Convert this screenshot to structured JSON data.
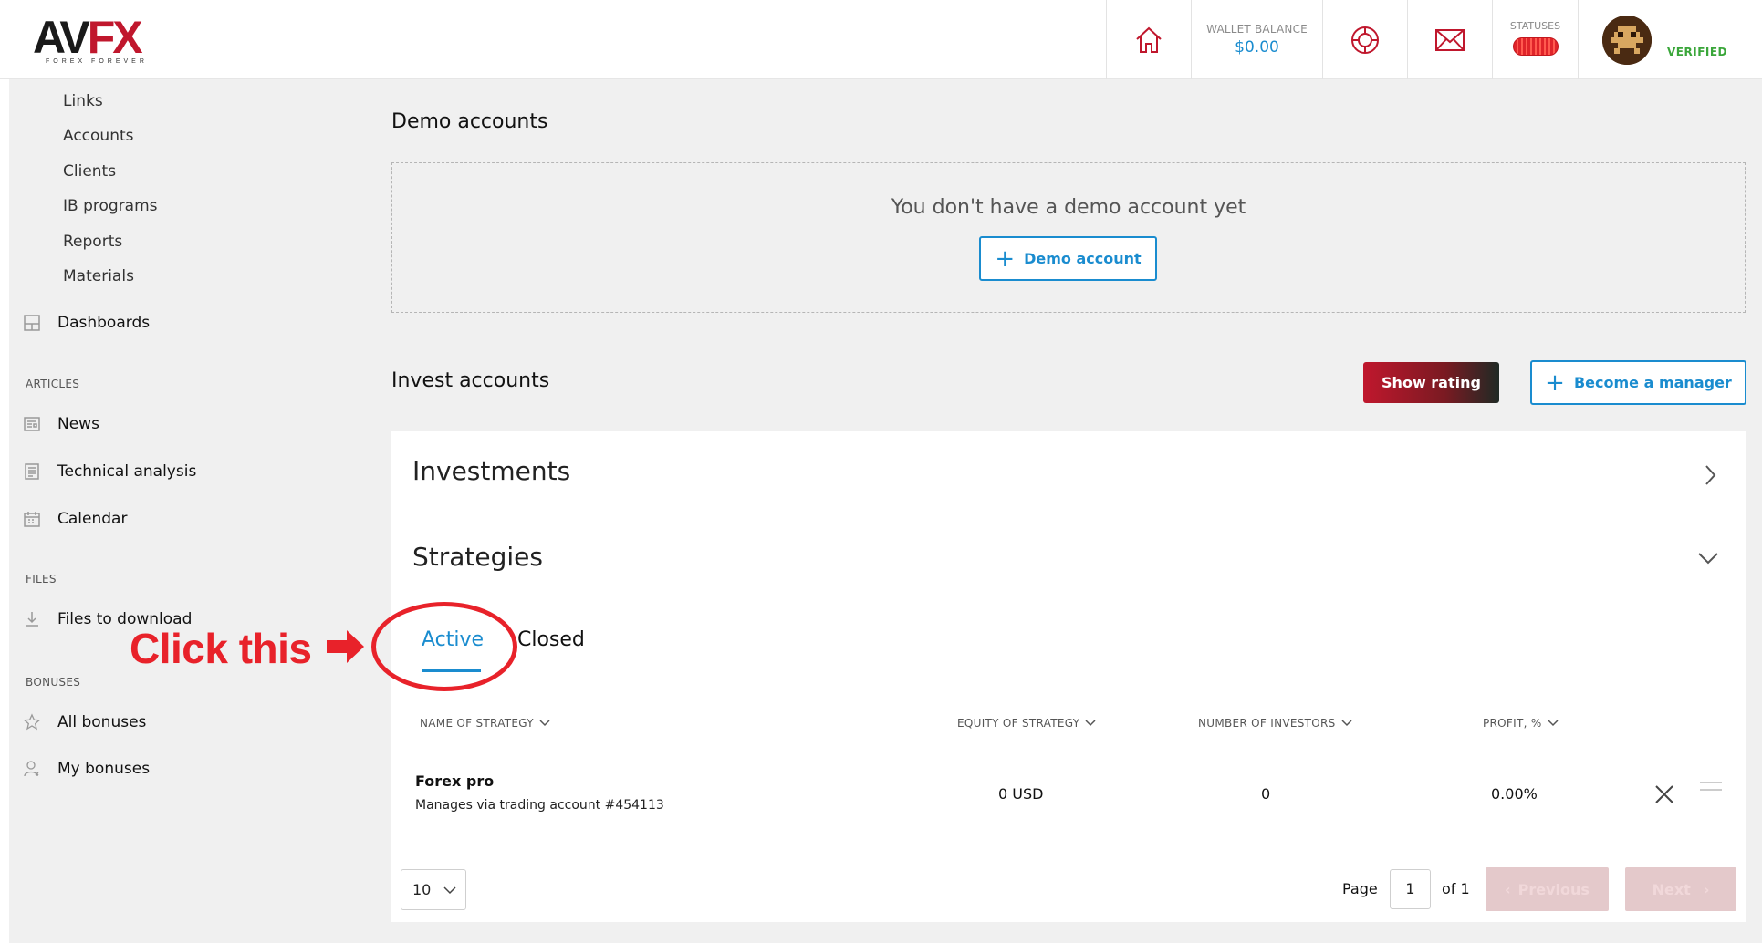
{
  "header": {
    "logo_text_a": "AV",
    "logo_text_b": "FX",
    "logo_sub": "FOREX FOREVER",
    "wallet_label": "WALLET BALANCE",
    "wallet_value": "$0.00",
    "statuses_label": "STATUSES",
    "verified_label": "VERIFIED",
    "icons": [
      "home-icon",
      "lifebuoy-icon",
      "mail-icon"
    ]
  },
  "sidebar": {
    "sub_items": [
      "Links",
      "Accounts",
      "Clients",
      "IB programs",
      "Reports",
      "Materials"
    ],
    "dashboards": "Dashboards",
    "articles_label": "ARTICLES",
    "articles": [
      "News",
      "Technical analysis",
      "Calendar"
    ],
    "files_label": "FILES",
    "files": [
      "Files to download"
    ],
    "bonuses_label": "BONUSES",
    "bonuses": [
      "All bonuses",
      "My bonuses"
    ]
  },
  "demo": {
    "title": "Demo accounts",
    "empty_text": "You don't have a demo account yet",
    "button_label": "Demo account"
  },
  "invest": {
    "title": "Invest accounts",
    "show_rating": "Show rating",
    "become_manager": "Become a manager",
    "investments_heading": "Investments",
    "strategies_heading": "Strategies",
    "tabs": [
      "Active",
      "Closed"
    ],
    "columns": [
      "NAME OF STRATEGY",
      "EQUITY OF STRATEGY",
      "NUMBER OF INVESTORS",
      "PROFIT, %"
    ],
    "rows": [
      {
        "name": "Forex pro",
        "sub": "Manages via trading account #454113",
        "equity": "0 USD",
        "investors": "0",
        "profit": "0.00%"
      }
    ],
    "pagination": {
      "per_page": "10",
      "page_label": "Page",
      "page_value": "1",
      "of_label": "of 1",
      "previous": "Previous",
      "next": "Next"
    }
  },
  "annotation": {
    "text": "Click this"
  },
  "colors": {
    "accent": "#1a8ccf",
    "brand_red": "#c0172d",
    "annotation_red": "#e8222a",
    "verified_green": "#3aa63a"
  }
}
